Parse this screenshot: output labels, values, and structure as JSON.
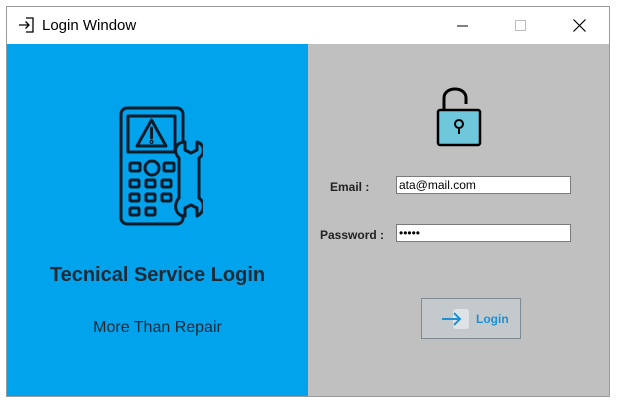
{
  "window": {
    "title": "Login Window",
    "title_icon": "sign-in-arrow-icon",
    "controls": [
      "minimize-icon",
      "maximize-icon",
      "close-icon"
    ]
  },
  "left_panel": {
    "icon": "device-repair-icon",
    "title": "Tecnical Service Login",
    "subtitle": "More Than Repair",
    "background_color": "#00a3ec"
  },
  "right_panel": {
    "icon": "unlocked-padlock-icon",
    "background_color": "#c0c0c0",
    "email": {
      "label": "Email :",
      "value": "ata@mail.com"
    },
    "password": {
      "label": "Password :",
      "value": "•••••"
    },
    "login_button": {
      "label": "Login",
      "icon": "login-arrow-icon",
      "label_color": "#1e90d6"
    }
  }
}
